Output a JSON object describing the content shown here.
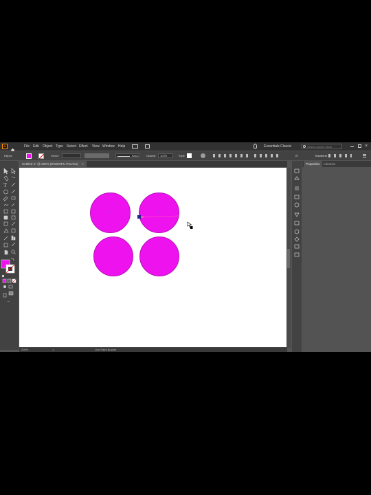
{
  "menubar": {
    "app_icon": "Ai",
    "menus": [
      "File",
      "Edit",
      "Object",
      "Type",
      "Select",
      "Effect",
      "View",
      "Window",
      "Help"
    ],
    "workspace": "Essentials Classic",
    "search_placeholder": "Search Adobe Stock"
  },
  "control_bar": {
    "selection_label": "Ellipse",
    "fill_color": "#ee12ee",
    "stroke_label": "Stroke",
    "brush_label": "Basic",
    "opacity_label": "Opacity",
    "opacity_value": "100%",
    "style_label": "Style",
    "transform_label": "Transform"
  },
  "document": {
    "tab_title": "Untitled-1* @ 200% (RGB/GPU Preview)"
  },
  "status": {
    "zoom": "200%",
    "artboard": "1",
    "tool_status": "Live Paint Bucket"
  },
  "right_panel": {
    "tabs": [
      "Properties",
      "Libraries"
    ]
  },
  "colors": {
    "shape_fill": "#ee12ee",
    "accent": "#ff9a00"
  },
  "icons": [
    "home-icon",
    "selection-tool-icon",
    "direct-selection-icon",
    "pen-tool-icon",
    "type-tool-icon",
    "ellipse-tool-icon",
    "hand-tool-icon",
    "zoom-tool-icon",
    "search-icon",
    "hand-cursor-icon"
  ]
}
